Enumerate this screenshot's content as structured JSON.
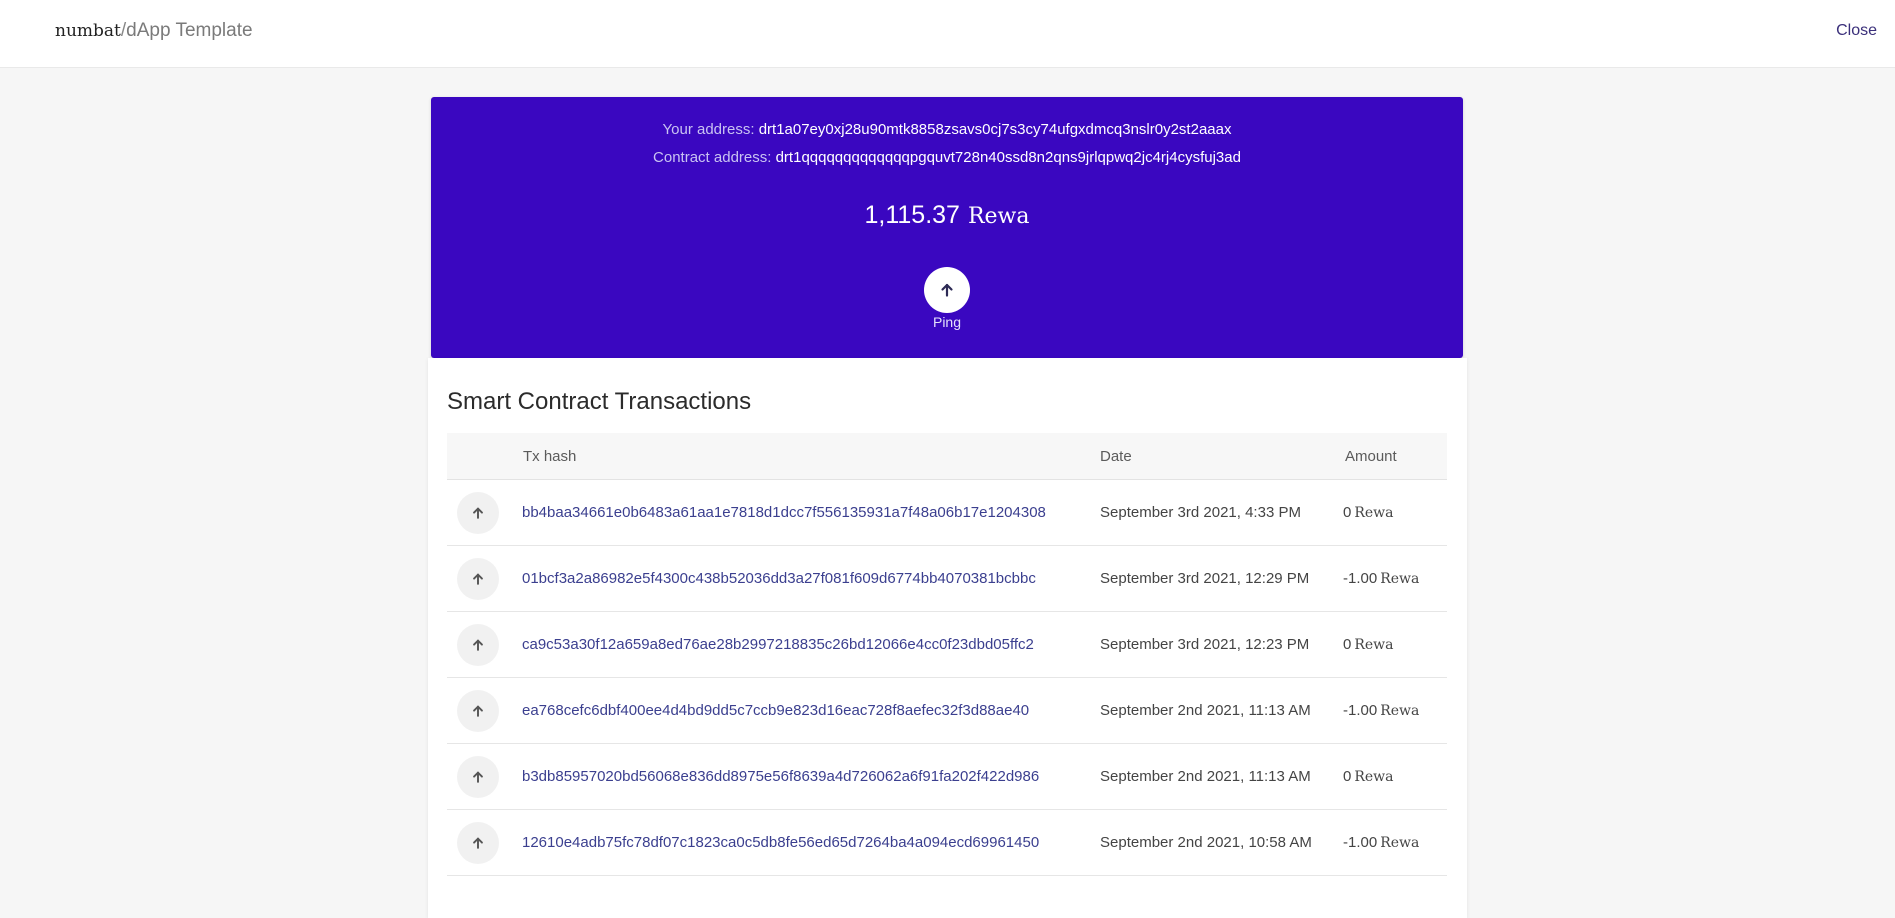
{
  "header": {
    "brand_logo": "numbat",
    "brand_separator": "/",
    "app_name": "dApp Template",
    "close_label": "Close"
  },
  "account": {
    "your_address_label": "Your address:",
    "your_address": "drt1a07ey0xj28u90mtk8858zsavs0cj7s3cy74ufgxdmcq3nslr0y2st2aaax",
    "contract_address_label": "Contract address:",
    "contract_address": "drt1qqqqqqqqqqqqqpgquvt728n40ssd8n2qns9jrlqpwq2jc4rj4cysfuj3ad",
    "balance": "1,115.37",
    "token": "Rewa",
    "ping_icon": "arrow-up-icon",
    "ping_label": "Ping"
  },
  "transactions": {
    "title": "Smart Contract Transactions",
    "columns": {
      "hash": "Tx hash",
      "date": "Date",
      "amount": "Amount"
    },
    "rows": [
      {
        "icon": "arrow-up-icon",
        "hash": "bb4baa34661e0b6483a61aa1e7818d1dcc7f556135931a7f48a06b17e1204308",
        "date": "September 3rd 2021, 4:33 PM",
        "amount": "0",
        "token": "Rewa"
      },
      {
        "icon": "arrow-up-icon",
        "hash": "01bcf3a2a86982e5f4300c438b52036dd3a27f081f609d6774bb4070381bcbbc",
        "date": "September 3rd 2021, 12:29 PM",
        "amount": "-1.00",
        "token": "Rewa"
      },
      {
        "icon": "arrow-up-icon",
        "hash": "ca9c53a30f12a659a8ed76ae28b2997218835c26bd12066e4cc0f23dbd05ffc2",
        "date": "September 3rd 2021, 12:23 PM",
        "amount": "0",
        "token": "Rewa"
      },
      {
        "icon": "arrow-up-icon",
        "hash": "ea768cefc6dbf400ee4d4bd9dd5c7ccb9e823d16eac728f8aefec32f3d88ae40",
        "date": "September 2nd 2021, 11:13 AM",
        "amount": "-1.00",
        "token": "Rewa"
      },
      {
        "icon": "arrow-up-icon",
        "hash": "b3db85957020bd56068e836dd8975e56f8639a4d726062a6f91fa202f422d986",
        "date": "September 2nd 2021, 11:13 AM",
        "amount": "0",
        "token": "Rewa"
      },
      {
        "icon": "arrow-up-icon",
        "hash": "12610e4adb75fc78df07c1823ca0c5db8fe56ed65d7264ba4a094ecd69961450",
        "date": "September 2nd 2021, 10:58 AM",
        "amount": "-1.00",
        "token": "Rewa"
      }
    ]
  }
}
